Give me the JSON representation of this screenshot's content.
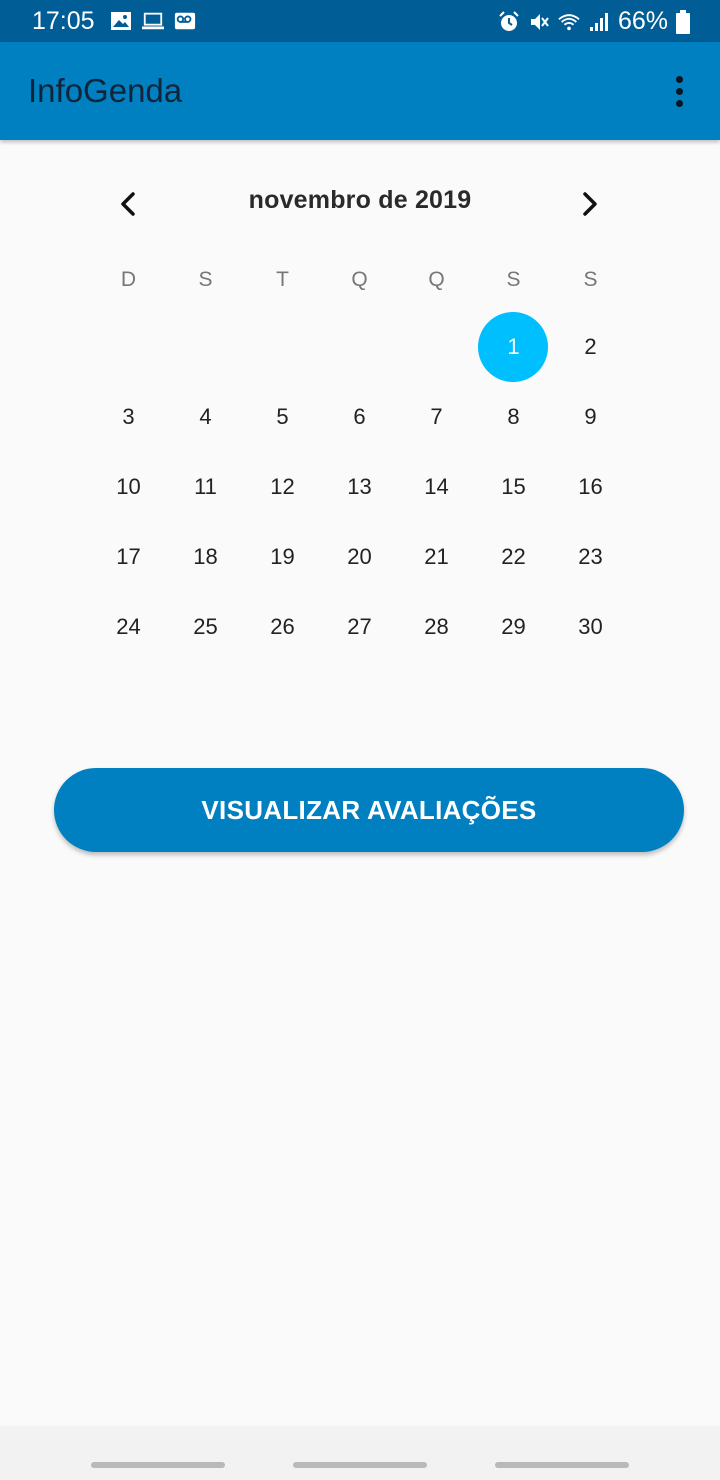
{
  "status_bar": {
    "time": "17:05",
    "battery": "66%",
    "icons_left": [
      "image-icon",
      "laptop-icon",
      "voicemail-icon"
    ],
    "icons_right": [
      "alarm-icon",
      "mute-icon",
      "wifi-icon",
      "signal-icon",
      "battery-icon"
    ]
  },
  "app_bar": {
    "title": "InfoGenda",
    "menu_icon": "more-vert-icon"
  },
  "calendar": {
    "month_label": "novembro de 2019",
    "weekdays": [
      "D",
      "S",
      "T",
      "Q",
      "Q",
      "S",
      "S"
    ],
    "selected_day": "1",
    "days": [
      "1",
      "2",
      "3",
      "4",
      "5",
      "6",
      "7",
      "8",
      "9",
      "10",
      "11",
      "12",
      "13",
      "14",
      "15",
      "16",
      "17",
      "18",
      "19",
      "20",
      "21",
      "22",
      "23",
      "24",
      "25",
      "26",
      "27",
      "28",
      "29",
      "30"
    ]
  },
  "actions": {
    "view_button": "VISUALIZAR AVALIAÇÕES"
  },
  "colors": {
    "status_bar": "#005d95",
    "app_bar": "#0080c0",
    "selected_day": "#00bfff",
    "background": "#fafafa"
  }
}
